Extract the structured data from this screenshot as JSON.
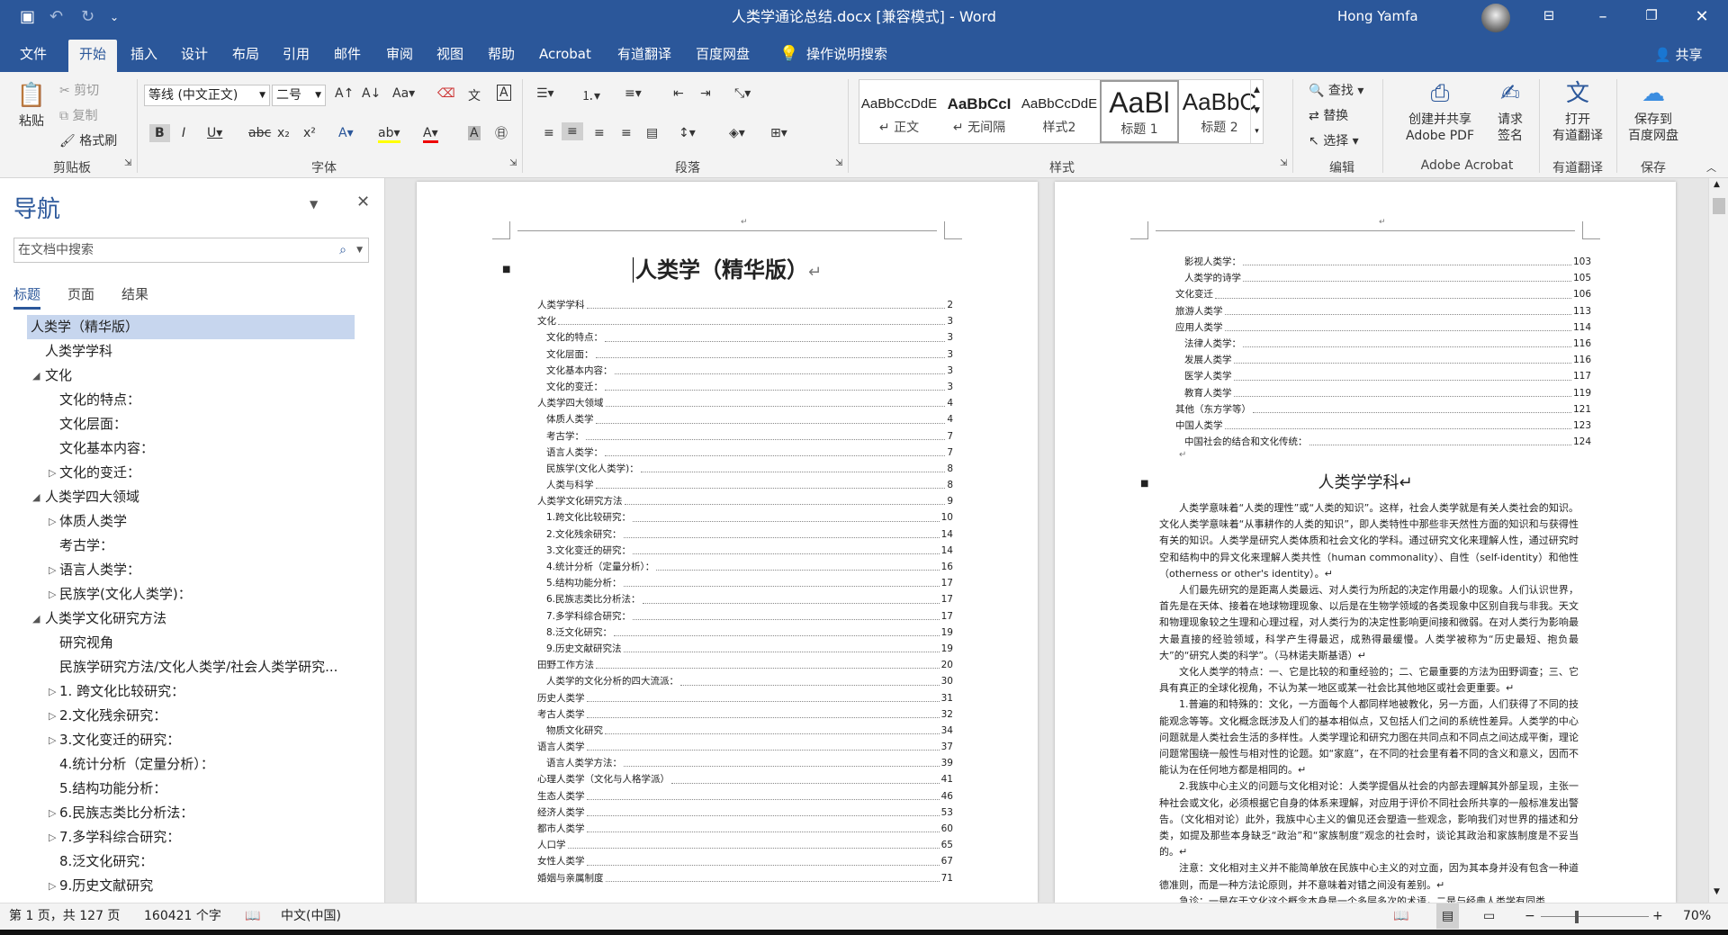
{
  "window": {
    "doc_title": "人类学通论总结.docx [兼容模式] - Word",
    "user": "Hong Yamfa",
    "qa_customize": "⌄"
  },
  "tabs": [
    "文件",
    "开始",
    "插入",
    "设计",
    "布局",
    "引用",
    "邮件",
    "审阅",
    "视图",
    "帮助",
    "Acrobat",
    "有道翻译",
    "百度网盘",
    "操作说明搜索"
  ],
  "share": "共享",
  "ribbon": {
    "clipboard": {
      "paste": "粘贴",
      "cut": "剪切",
      "copy": "复制",
      "format_painter": "格式刷",
      "label": "剪贴板"
    },
    "font": {
      "font_name": "等线 (中文正文)",
      "font_size": "二号",
      "label": "字体"
    },
    "paragraph": {
      "label": "段落"
    },
    "styles": {
      "label": "样式",
      "items": [
        {
          "preview": "AaBbCcDdE",
          "name": "↵ 正文"
        },
        {
          "preview": "AaBbCcI",
          "name": "↵ 无间隔"
        },
        {
          "preview": "AaBbCcDdE",
          "name": "样式2"
        },
        {
          "preview": "AaBl",
          "name": "标题 1"
        },
        {
          "preview": "AaBbC",
          "name": "标题 2"
        }
      ]
    },
    "editing": {
      "find": "查找",
      "replace": "替换",
      "select": "选择",
      "label": "编辑"
    },
    "acrobat": {
      "create": "创建并共享",
      "create2": "Adobe PDF",
      "sign": "请求",
      "sign2": "签名",
      "label": "Adobe Acrobat"
    },
    "youdao": {
      "open": "打开",
      "open2": "有道翻译",
      "label": "有道翻译"
    },
    "baidu": {
      "save": "保存到",
      "save2": "百度网盘",
      "label": "保存"
    }
  },
  "nav": {
    "title": "导航",
    "search_placeholder": "在文档中搜索",
    "tabs": [
      "标题",
      "页面",
      "结果"
    ],
    "tree": [
      {
        "label": "人类学（精华版）",
        "level": 0,
        "exp": "open",
        "sel": true
      },
      {
        "label": "人类学学科",
        "level": 1,
        "exp": "none"
      },
      {
        "label": "文化",
        "level": 1,
        "exp": "open"
      },
      {
        "label": "文化的特点：",
        "level": 2,
        "exp": "none"
      },
      {
        "label": "文化层面：",
        "level": 2,
        "exp": "none"
      },
      {
        "label": "文化基本内容：",
        "level": 2,
        "exp": "none"
      },
      {
        "label": "文化的变迁：",
        "level": 2,
        "exp": "closed"
      },
      {
        "label": "人类学四大领域",
        "level": 1,
        "exp": "open"
      },
      {
        "label": "体质人类学",
        "level": 2,
        "exp": "closed"
      },
      {
        "label": "考古学：",
        "level": 2,
        "exp": "none"
      },
      {
        "label": "语言人类学：",
        "level": 2,
        "exp": "closed"
      },
      {
        "label": "民族学(文化人类学)：",
        "level": 2,
        "exp": "closed"
      },
      {
        "label": "人类学文化研究方法",
        "level": 1,
        "exp": "open"
      },
      {
        "label": "研究视角",
        "level": 2,
        "exp": "none"
      },
      {
        "label": "民族学研究方法/文化人类学/社会人类学研究...",
        "level": 2,
        "exp": "none"
      },
      {
        "label": "1. 跨文化比较研究：",
        "level": 2,
        "exp": "closed"
      },
      {
        "label": "2.文化残余研究：",
        "level": 2,
        "exp": "closed"
      },
      {
        "label": "3.文化变迁的研究：",
        "level": 2,
        "exp": "closed"
      },
      {
        "label": "4.统计分析（定量分析）：",
        "level": 2,
        "exp": "none"
      },
      {
        "label": "5.结构功能分析：",
        "level": 2,
        "exp": "none"
      },
      {
        "label": "6.民族志类比分析法：",
        "level": 2,
        "exp": "closed"
      },
      {
        "label": "7.多学科综合研究：",
        "level": 2,
        "exp": "closed"
      },
      {
        "label": "8.泛文化研究：",
        "level": 2,
        "exp": "none"
      },
      {
        "label": "9.历史文献研究",
        "level": 2,
        "exp": "closed"
      }
    ]
  },
  "page1": {
    "header_mark": "↵",
    "title": "人类学（精华版）",
    "title_mark": "↵",
    "toc": [
      {
        "t": "人类学学科",
        "p": "2",
        "i": 0
      },
      {
        "t": "文化",
        "p": "3",
        "i": 0
      },
      {
        "t": "文化的特点：",
        "p": "3",
        "i": 1
      },
      {
        "t": "文化层面：",
        "p": "3",
        "i": 1
      },
      {
        "t": "文化基本内容：",
        "p": "3",
        "i": 1
      },
      {
        "t": "文化的变迁：",
        "p": "3",
        "i": 1
      },
      {
        "t": "人类学四大领域",
        "p": "4",
        "i": 0
      },
      {
        "t": "体质人类学",
        "p": "4",
        "i": 1
      },
      {
        "t": "考古学：",
        "p": "7",
        "i": 1
      },
      {
        "t": "语言人类学：",
        "p": "7",
        "i": 1
      },
      {
        "t": "民族学(文化人类学)：",
        "p": "8",
        "i": 1
      },
      {
        "t": "人类与科学",
        "p": "8",
        "i": 1
      },
      {
        "t": "人类学文化研究方法",
        "p": "9",
        "i": 0
      },
      {
        "t": "1.跨文化比较研究：",
        "p": "10",
        "i": 1
      },
      {
        "t": "2.文化残余研究：",
        "p": "14",
        "i": 1
      },
      {
        "t": "3.文化变迁的研究：",
        "p": "14",
        "i": 1
      },
      {
        "t": "4.统计分析（定量分析）：",
        "p": "16",
        "i": 1
      },
      {
        "t": "5.结构功能分析：",
        "p": "17",
        "i": 1
      },
      {
        "t": "6.民族志类比分析法：",
        "p": "17",
        "i": 1
      },
      {
        "t": "7.多学科综合研究：",
        "p": "17",
        "i": 1
      },
      {
        "t": "8.泛文化研究：",
        "p": "19",
        "i": 1
      },
      {
        "t": "9.历史文献研究法",
        "p": "19",
        "i": 1
      },
      {
        "t": "田野工作方法",
        "p": "20",
        "i": 0
      },
      {
        "t": "人类学的文化分析的四大流派：",
        "p": "30",
        "i": 1
      },
      {
        "t": "历史人类学",
        "p": "31",
        "i": 0
      },
      {
        "t": "考古人类学",
        "p": "32",
        "i": 0
      },
      {
        "t": "物质文化研究",
        "p": "34",
        "i": 1
      },
      {
        "t": "语言人类学",
        "p": "37",
        "i": 0
      },
      {
        "t": "语言人类学方法：",
        "p": "39",
        "i": 1
      },
      {
        "t": "心理人类学（文化与人格学派）",
        "p": "41",
        "i": 0
      },
      {
        "t": "生态人类学",
        "p": "46",
        "i": 0
      },
      {
        "t": "经济人类学",
        "p": "53",
        "i": 0
      },
      {
        "t": "都市人类学",
        "p": "60",
        "i": 0
      },
      {
        "t": "人口学",
        "p": "65",
        "i": 0
      },
      {
        "t": "女性人类学",
        "p": "67",
        "i": 0
      },
      {
        "t": "婚姻与亲属制度",
        "p": "71",
        "i": 0
      }
    ]
  },
  "page2": {
    "header_mark": "↵",
    "toc": [
      {
        "t": "影视人类学：",
        "p": "103",
        "i": 1
      },
      {
        "t": "人类学的诗学",
        "p": "105",
        "i": 1
      },
      {
        "t": "文化变迁",
        "p": "106",
        "i": 0
      },
      {
        "t": "旅游人类学",
        "p": "113",
        "i": 0
      },
      {
        "t": "应用人类学",
        "p": "114",
        "i": 0
      },
      {
        "t": "法律人类学：",
        "p": "116",
        "i": 1
      },
      {
        "t": "发展人类学",
        "p": "116",
        "i": 1
      },
      {
        "t": "医学人类学",
        "p": "117",
        "i": 1
      },
      {
        "t": "教育人类学",
        "p": "119",
        "i": 1
      },
      {
        "t": "其他（东方学等）",
        "p": "121",
        "i": 0
      },
      {
        "t": "中国人类学",
        "p": "123",
        "i": 0
      },
      {
        "t": "中国社会的结合和文化传统：",
        "p": "124",
        "i": 1
      }
    ],
    "end_mark": "↵",
    "heading": "人类学学科↵",
    "paras": [
      "人类学意味着“人类的理性”或“人类的知识”。这样，社会人类学就是有关人类社会的知识。文化人类学意味着“从事耕作的人类的知识”，即人类特性中那些非天然性方面的知识和与获得性有关的知识。人类学是研究人类体质和社会文化的学科。通过研究文化来理解人性，通过研究时空和结构中的异文化来理解人类共性（human commonality）、自性（self-identity）和他性（otherness or other's identity）。↵",
      "人们最先研究的是距离人类最远、对人类行为所起的决定作用最小的现象。人们认识世界，首先是在天体、接着在地球物理现象、以后是在生物学领域的各类现象中区别自我与非我。天文和物理现象较之生理和心理过程，对人类行为的决定性影响更间接和微弱。在对人类行为影响最大最直接的经验领域，科学产生得最迟，成熟得最缓慢。人类学被称为“历史最短、抱负最大”的“研究人类的科学”。（马林诺夫斯基语）↵",
      "文化人类学的特点：一、它是比较的和重经验的；二、它最重要的方法为田野调查；三、它具有真正的全球化视角，不认为某一地区或某一社会比其他地区或社会更重要。↵",
      "1.普遍的和特殊的：文化，一方面每个人都同样地被教化，另一方面，人们获得了不同的技能观念等等。文化概念既涉及人们的基本相似点，又包括人们之间的系统性差异。人类学的中心问题就是人类社会生活的多样性。人类学理论和研究力图在共同点和不同点之间达成平衡，理论问题常围绕一般性与相对性的论题。如“家庭”，在不同的社会里有着不同的含义和意义，因而不能认为在任何地方都是相同的。↵",
      "2.我族中心主义的问题与文化相对论：人类学提倡从社会的内部去理解其外部呈现，主张一种社会或文化，必须根据它自身的体系来理解，对应用于评价不同社会所共享的一般标准发出警告。（文化相对论）此外，我族中心主义的偏见还会塑造一些观念，影响我们对世界的描述和分类，如提及那些本身缺乏“政治”和“家族制度”观念的社会时，谈论其政治和家族制度是不妥当的。↵",
      "注意：文化相对主义并不能简单放在民族中心主义的对立面，因为其本身并没有包含一种道德准则，而是一种方法论原则，并不意味着对错之间没有差别。↵",
      "急诊：一是在于文化这个概念本身是一个多层多次的术语，二是与经典人类学有同类"
    ]
  },
  "status": {
    "pages": "第 1 页，共 127 页",
    "words": "160421 个字",
    "lang": "中文(中国)",
    "zoom": "70%"
  },
  "colors": {
    "accent": "#2b579a"
  }
}
